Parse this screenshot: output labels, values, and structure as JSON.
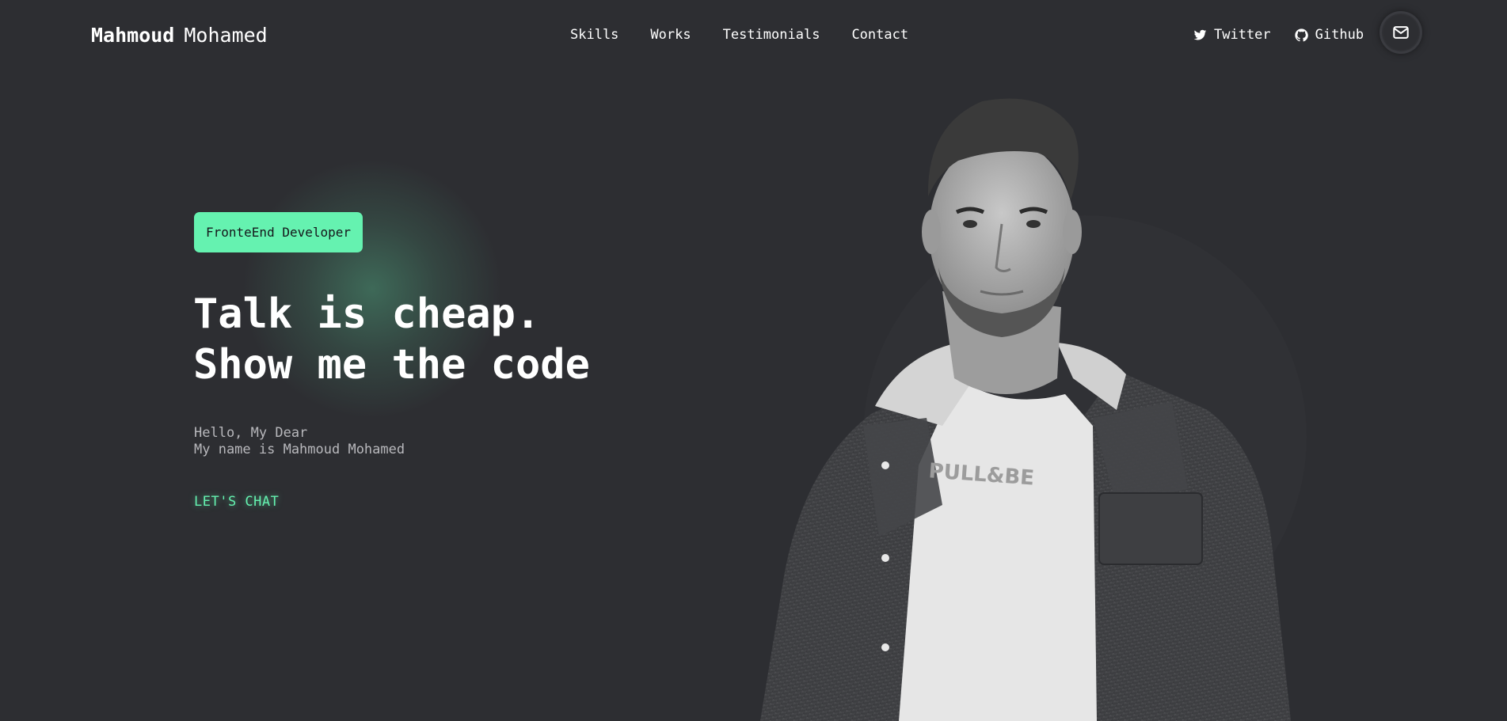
{
  "header": {
    "logo_first": "Mahmoud",
    "logo_last": "Mohamed",
    "nav": [
      {
        "label": "Skills"
      },
      {
        "label": "Works"
      },
      {
        "label": "Testimonials"
      },
      {
        "label": "Contact"
      }
    ],
    "social": [
      {
        "label": "Twitter",
        "icon": "twitter-icon"
      },
      {
        "label": "Github",
        "icon": "github-icon"
      }
    ],
    "mail_icon": "envelope-icon"
  },
  "hero": {
    "badge": "FronteEnd Developer",
    "headline_line1": "Talk is cheap.",
    "headline_line2": "Show me the code",
    "intro_line1": "Hello, My Dear",
    "intro_line2": "My name is Mahmoud Mohamed",
    "cta": "LET'S CHAT"
  },
  "colors": {
    "background": "#2d2e32",
    "accent": "#65f2b0",
    "text": "#ffffff",
    "muted_text": "#b8b8bc"
  }
}
